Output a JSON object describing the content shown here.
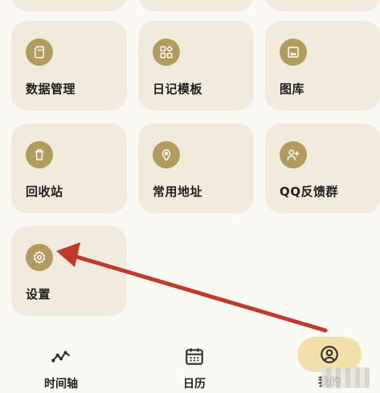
{
  "tiles": [
    {
      "id": "data-management",
      "label": "数据管理",
      "icon": "sd-card-icon"
    },
    {
      "id": "diary-template",
      "label": "日记模板",
      "icon": "template-grid-icon"
    },
    {
      "id": "gallery",
      "label": "图库",
      "icon": "image-icon"
    },
    {
      "id": "recycle-bin",
      "label": "回收站",
      "icon": "trash-icon"
    },
    {
      "id": "common-address",
      "label": "常用地址",
      "icon": "location-pin-icon"
    },
    {
      "id": "qq-group",
      "label": "QQ反馈群",
      "icon": "add-person-icon"
    },
    {
      "id": "settings",
      "label": "设置",
      "icon": "gear-icon"
    }
  ],
  "nav": {
    "timeline": "时间轴",
    "calendar": "日历",
    "mine": "我的"
  },
  "colors": {
    "tile_bg": "#f2eadd",
    "icon_bg": "#b39b5d",
    "active_nav": "#f3dfaa",
    "arrow": "#c0392b"
  }
}
